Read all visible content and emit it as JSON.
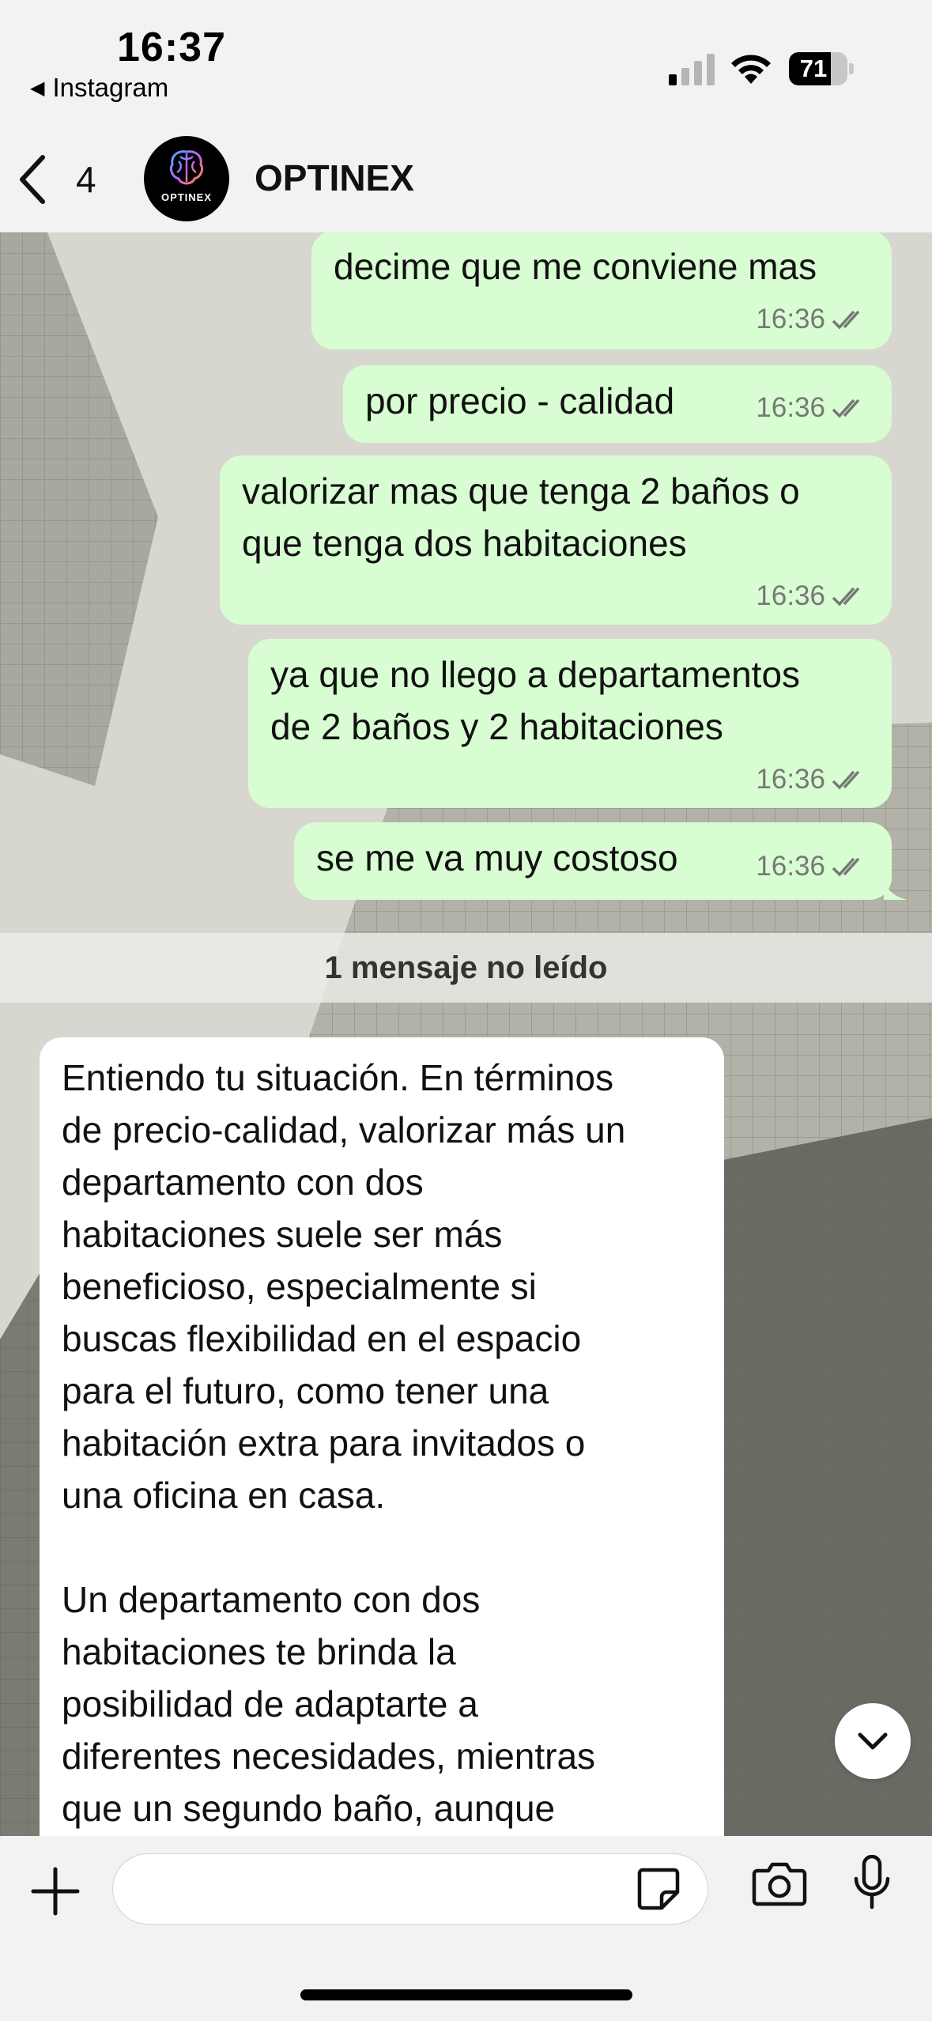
{
  "status_bar": {
    "time": "16:37",
    "back_app": "Instagram",
    "battery_level": "71",
    "battery_fraction": 0.71
  },
  "header": {
    "back_count": "4",
    "contact_name": "OPTINEX",
    "avatar_logo_text": "OPTINEX"
  },
  "messages_out": [
    {
      "text": "decime que me conviene mas",
      "time": "16:36"
    },
    {
      "text": "por precio - calidad",
      "time": "16:36"
    },
    {
      "lines": [
        "valorizar mas que tenga 2 baños o",
        "que tenga dos habitaciones"
      ],
      "time": "16:36"
    },
    {
      "lines": [
        "ya que no llego a departamentos",
        "de 2 baños y 2 habitaciones"
      ],
      "time": "16:36"
    },
    {
      "text": "se me va muy costoso",
      "time": "16:36"
    }
  ],
  "unread_label": "1 mensaje no leído",
  "message_in": {
    "paragraph1": [
      "Entiendo tu situación. En términos",
      "de precio-calidad, valorizar más un",
      "departamento con dos",
      "habitaciones suele ser más",
      "beneficioso, especialmente si",
      "buscas flexibilidad en el espacio",
      "para el futuro, como tener una",
      "habitación extra para invitados o",
      "una oficina en casa."
    ],
    "paragraph2": [
      "Un departamento con dos",
      "habitaciones te brinda la",
      "posibilidad de adaptarte a",
      "diferentes necesidades, mientras",
      "que un segundo baño, aunque"
    ]
  },
  "composer": {
    "placeholder": ""
  },
  "icons": {
    "back": "chevron-left-icon",
    "plus": "plus-icon",
    "sticker": "sticker-icon",
    "camera": "camera-icon",
    "mic": "microphone-icon",
    "scroll_down": "chevron-down-icon",
    "read_receipt": "double-check-icon"
  },
  "colors": {
    "outgoing_bubble": "#d8fdd2",
    "incoming_bubble": "#ffffff",
    "read_check": "#777777"
  }
}
